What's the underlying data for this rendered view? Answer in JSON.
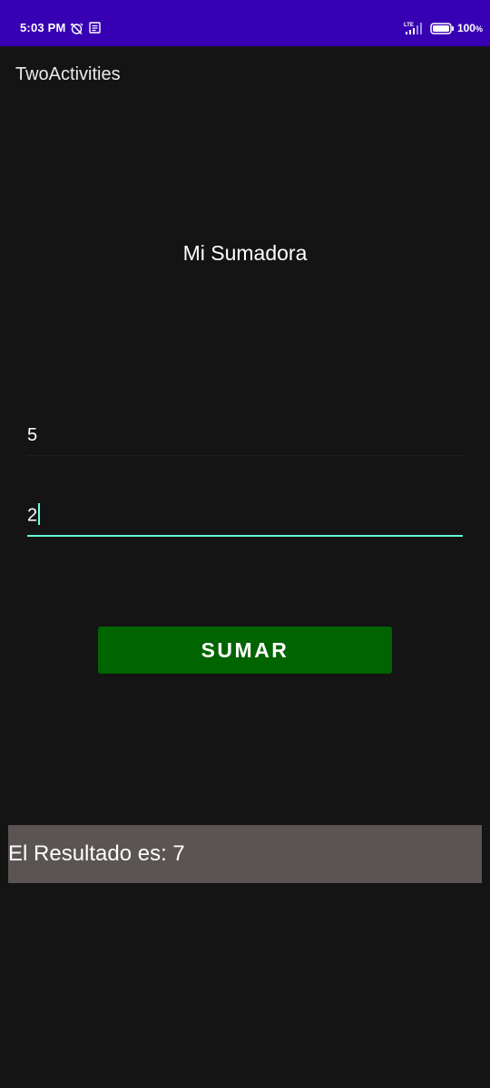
{
  "status_bar": {
    "time": "5:03 PM",
    "network_label": "LTE",
    "battery": "100",
    "battery_unit": "%"
  },
  "app_bar": {
    "title": "TwoActivities"
  },
  "main": {
    "heading": "Mi Sumadora",
    "first_number": "5",
    "second_number": "2",
    "button_label": "SUMAR",
    "result_label": "El Resultado es: 7"
  },
  "colors": {
    "status_bar": "#3700b3",
    "background": "#141414",
    "button": "#006400",
    "accent": "#64ffda",
    "result_background": "#5a5453"
  },
  "icons": [
    "alarm-off-icon",
    "notification-icon",
    "signal-icon",
    "battery-icon"
  ]
}
